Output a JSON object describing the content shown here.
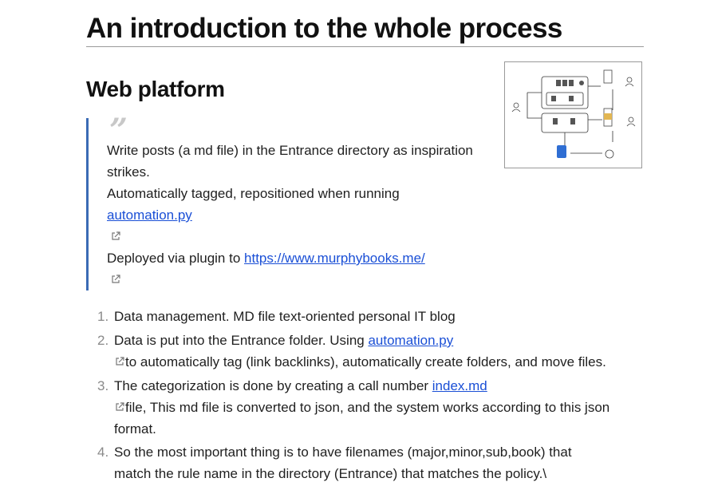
{
  "document": {
    "title": "An introduction to the whole process",
    "section_title": "Web platform",
    "quote": {
      "mark": "”",
      "line1": "Write posts (a md file) in the Entrance directory as inspiration",
      "line2": "strikes.",
      "line3": "Automatically tagged, repositioned when running",
      "link1": "automation.py",
      "line5_prefix": "Deployed via plugin to ",
      "link2": "https://www.murphybooks.me/"
    },
    "list": [
      {
        "num": "1.",
        "line1": "Data management. MD file text-oriented personal IT blog"
      },
      {
        "num": "2.",
        "line1_prefix": "Data is put into the Entrance folder. Using ",
        "link": "automation.py",
        "line2": "to automatically tag (link backlinks), automatically create folders, and move files."
      },
      {
        "num": "3.",
        "line1_prefix": "The categorization is done by creating a call number ",
        "link": "index.md",
        "line2": "file, This md file is converted to json, and the system works according to this json",
        "line3": "format."
      },
      {
        "num": "4.",
        "line1": "So the most important thing is to have filenames (major,minor,sub,book) that",
        "line2": "match the rule name in the directory (Entrance) that matches the policy.\\"
      }
    ]
  },
  "icons": {
    "external_link": "external-link-icon",
    "diagram": "workflow-diagram-thumbnail"
  },
  "colors": {
    "link": "#1a4fd6",
    "quote_border": "#3b6bb5",
    "list_number": "#8a8a8a"
  }
}
